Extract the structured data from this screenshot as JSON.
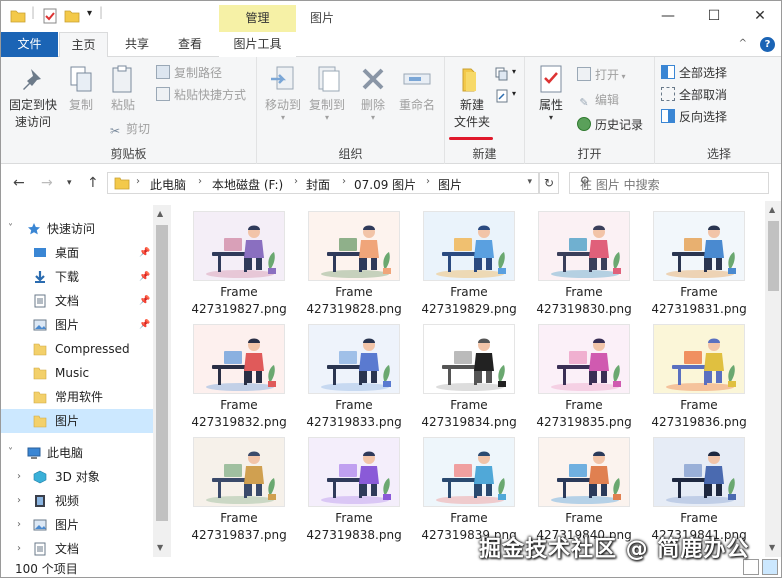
{
  "titlebar": {
    "context_tab": "管理",
    "title": "图片",
    "minimize": "—",
    "maximize": "☐",
    "close": "✕"
  },
  "tabs": {
    "file": "文件",
    "home": "主页",
    "share": "共享",
    "view": "查看",
    "picture_tools": "图片工具"
  },
  "ribbon": {
    "clipboard": {
      "label": "剪贴板",
      "pin": "固定到快\n速访问",
      "pin_l1": "固定到快",
      "pin_l2": "速访问",
      "copy": "复制",
      "paste": "粘贴",
      "copy_path": "复制路径",
      "paste_shortcut": "粘贴快捷方式",
      "cut": "剪切"
    },
    "organize": {
      "label": "组织",
      "move_to": "移动到",
      "copy_to": "复制到",
      "delete": "删除",
      "rename": "重命名"
    },
    "new": {
      "label": "新建",
      "new_folder_l1": "新建",
      "new_folder_l2": "文件夹"
    },
    "open": {
      "label": "打开",
      "properties": "属性",
      "open": "打开",
      "edit": "编辑",
      "history": "历史记录"
    },
    "select": {
      "label": "选择",
      "select_all": "全部选择",
      "select_none": "全部取消",
      "invert": "反向选择"
    }
  },
  "address": {
    "crumbs": [
      "此电脑",
      "本地磁盘 (F:)",
      "封面",
      "07.09 图片",
      "图片"
    ],
    "search_placeholder": "在 图片 中搜索"
  },
  "nav": {
    "quick_access": "快速访问",
    "items": [
      "桌面",
      "下载",
      "文档",
      "图片",
      "Compressed",
      "Music",
      "常用软件",
      "图片"
    ],
    "this_pc": "此电脑",
    "pc_items": [
      "3D 对象",
      "视频",
      "图片",
      "文档"
    ]
  },
  "files": [
    {
      "l1": "Frame",
      "l2": "427319827.png"
    },
    {
      "l1": "Frame",
      "l2": "427319828.png"
    },
    {
      "l1": "Frame",
      "l2": "427319829.png"
    },
    {
      "l1": "Frame",
      "l2": "427319830.png"
    },
    {
      "l1": "Frame",
      "l2": "427319831.png"
    },
    {
      "l1": "Frame",
      "l2": "427319832.png"
    },
    {
      "l1": "Frame",
      "l2": "427319833.png"
    },
    {
      "l1": "Frame",
      "l2": "427319834.png"
    },
    {
      "l1": "Frame",
      "l2": "427319835.png"
    },
    {
      "l1": "Frame",
      "l2": "427319836.png"
    },
    {
      "l1": "Frame",
      "l2": "427319837.png"
    },
    {
      "l1": "Frame",
      "l2": "427319838.png"
    },
    {
      "l1": "Frame",
      "l2": "427319839.png"
    },
    {
      "l1": "Frame",
      "l2": "427319840.png"
    },
    {
      "l1": "Frame",
      "l2": "427319841.png"
    }
  ],
  "status": {
    "count": "100 个项目"
  },
  "watermark": "掘金技术社区 @ 简鹿办公",
  "colors": {
    "accent": "#1b64b5",
    "context_tab": "#f6f1a6",
    "selection": "#cce8ff",
    "annotation_underline": "#e0192b"
  }
}
